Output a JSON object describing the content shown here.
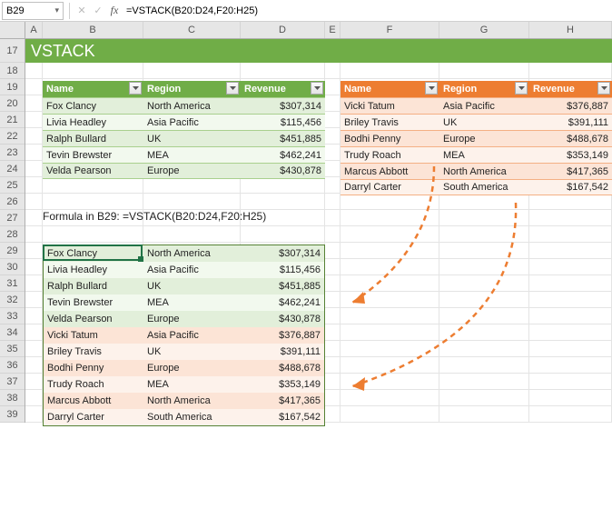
{
  "nameBox": "B29",
  "formulaBar": "=VSTACK(B20:D24,F20:H25)",
  "columns": [
    "A",
    "B",
    "C",
    "D",
    "E",
    "F",
    "G",
    "H"
  ],
  "rows": [
    "17",
    "18",
    "19",
    "20",
    "21",
    "22",
    "23",
    "24",
    "25",
    "26",
    "27",
    "28",
    "29",
    "30",
    "31",
    "32",
    "33",
    "34",
    "35",
    "36",
    "37",
    "38",
    "39"
  ],
  "title": "VSTACK",
  "table1": {
    "headers": [
      "Name",
      "Region",
      "Revenue"
    ],
    "rows": [
      [
        "Fox Clancy",
        "North America",
        "$307,314"
      ],
      [
        "Livia Headley",
        "Asia Pacific",
        "$115,456"
      ],
      [
        "Ralph Bullard",
        "UK",
        "$451,885"
      ],
      [
        "Tevin Brewster",
        "MEA",
        "$462,241"
      ],
      [
        "Velda Pearson",
        "Europe",
        "$430,878"
      ]
    ]
  },
  "table2": {
    "headers": [
      "Name",
      "Region",
      "Revenue"
    ],
    "rows": [
      [
        "Vicki Tatum",
        "Asia Pacific",
        "$376,887"
      ],
      [
        "Briley Travis",
        "UK",
        "$391,111"
      ],
      [
        "Bodhi Penny",
        "Europe",
        "$488,678"
      ],
      [
        "Trudy Roach",
        "MEA",
        "$353,149"
      ],
      [
        "Marcus Abbott",
        "North America",
        "$417,365"
      ],
      [
        "Darryl Carter",
        "South America",
        "$167,542"
      ]
    ]
  },
  "formulaLabel": "Formula in B29: =VSTACK(B20:D24,F20:H25)",
  "result": [
    {
      "style": "g-light",
      "cells": [
        "Fox Clancy",
        "North America",
        "$307,314"
      ]
    },
    {
      "style": "g-lighter",
      "cells": [
        "Livia Headley",
        "Asia Pacific",
        "$115,456"
      ]
    },
    {
      "style": "g-light",
      "cells": [
        "Ralph Bullard",
        "UK",
        "$451,885"
      ]
    },
    {
      "style": "g-lighter",
      "cells": [
        "Tevin Brewster",
        "MEA",
        "$462,241"
      ]
    },
    {
      "style": "g-light",
      "cells": [
        "Velda Pearson",
        "Europe",
        "$430,878"
      ]
    },
    {
      "style": "o-light",
      "cells": [
        "Vicki Tatum",
        "Asia Pacific",
        "$376,887"
      ]
    },
    {
      "style": "o-lighter",
      "cells": [
        "Briley Travis",
        "UK",
        "$391,111"
      ]
    },
    {
      "style": "o-light",
      "cells": [
        "Bodhi Penny",
        "Europe",
        "$488,678"
      ]
    },
    {
      "style": "o-lighter",
      "cells": [
        "Trudy Roach",
        "MEA",
        "$353,149"
      ]
    },
    {
      "style": "o-light",
      "cells": [
        "Marcus Abbott",
        "North America",
        "$417,365"
      ]
    },
    {
      "style": "o-lighter",
      "cells": [
        "Darryl Carter",
        "South America",
        "$167,542"
      ]
    }
  ],
  "colWidths": {
    "A": 19,
    "B": 111,
    "C": 107,
    "D": 93,
    "E": 17,
    "F": 109,
    "G": 99,
    "H": 91
  }
}
